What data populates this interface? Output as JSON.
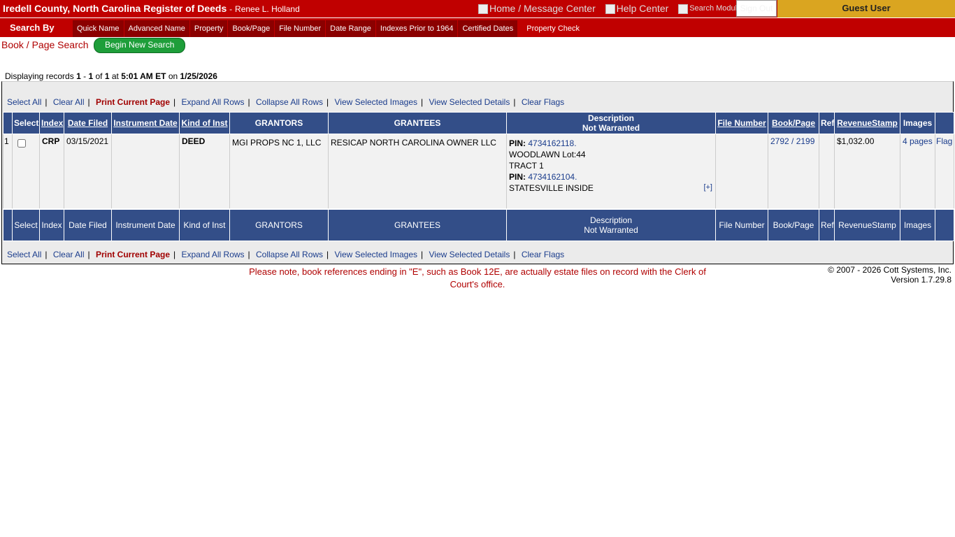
{
  "header": {
    "title": "Iredell County, North Carolina Register of Deeds",
    "separator": "-",
    "person": "Renee L. Holland",
    "links": [
      {
        "label": "Home / Message Center"
      },
      {
        "label": "Help Center"
      },
      {
        "label": "Search Module"
      }
    ],
    "sign_out": "Sign Out",
    "guest_user": "Guest User"
  },
  "nav": {
    "search_by": "Search By",
    "tabs": [
      "Quick Name",
      "Advanced Name",
      "Property",
      "Book/Page",
      "File Number",
      "Date Range",
      "Indexes Prior to 1964",
      "Certified Dates",
      "Property Check"
    ]
  },
  "page": {
    "title": "Book / Page Search",
    "begin_new_search": "Begin New Search"
  },
  "records": {
    "prefix": "Displaying records",
    "from": "1",
    "dash": "-",
    "to": "1",
    "of_label": "of",
    "total": "1",
    "at_label": "at",
    "time": "5:01 AM ET",
    "on_label": "on",
    "date": "1/25/2026"
  },
  "actions": [
    "Select All",
    "Clear All",
    "Print Current Page",
    "Expand All Rows",
    "Collapse All Rows",
    "View Selected Images",
    "View Selected Details",
    "Clear Flags"
  ],
  "separator": "|",
  "table": {
    "headers": [
      "Select",
      "Index",
      "Date Filed",
      "Instrument Date",
      "Kind of Inst",
      "GRANTORS",
      "GRANTEES",
      "Description",
      "Not Warranted",
      "File Number",
      "Book/Page",
      "Ref",
      "RevenueStamp",
      "Images"
    ],
    "row": {
      "num": "1",
      "index": "CRP",
      "date_filed": "03/15/2021",
      "instrument_date": "",
      "kind": "DEED",
      "grantors": "MGI PROPS NC 1, LLC",
      "grantees": "RESICAP NORTH CAROLINA OWNER LLC",
      "pin_label": "PIN:",
      "pin1": "4734162118.",
      "line2": "WOODLAWN Lot:44",
      "line3": "TRACT 1",
      "pin2": "4734162104.",
      "line5": "STATESVILLE INSIDE",
      "expand": "[+]",
      "file_number": "",
      "book_page": "2792 / 2199",
      "ref": "",
      "revenue_stamp": "$1,032.00",
      "images": "4 pages",
      "flag": "Flag"
    }
  },
  "footer": {
    "note": "Please note, book references ending in \"E\", such as Book 12E, are actually estate files on record with the Clerk of Court's office.",
    "copyright": "© 2007 - 2026 Cott Systems, Inc.",
    "version": "Version 1.7.29.8"
  },
  "colors": {
    "header_red": "#c00000",
    "tab_dark_red": "#8b0000",
    "guest_gold": "#daa520",
    "table_header_blue": "#334e88",
    "button_green": "#1e9e3a"
  }
}
